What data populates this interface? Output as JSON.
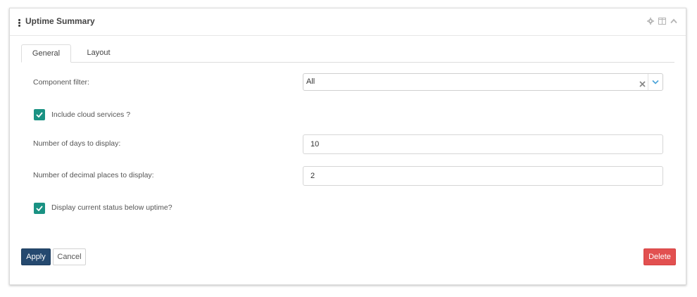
{
  "panel": {
    "title": "Uptime Summary",
    "header_icons": [
      "gear-icon",
      "columns-icon",
      "chevron-up-icon"
    ]
  },
  "tabs": [
    {
      "label": "General",
      "active": true
    },
    {
      "label": "Layout",
      "active": false
    }
  ],
  "form": {
    "component_filter": {
      "label": "Component filter:",
      "value": "All"
    },
    "include_cloud": {
      "label": "Include cloud services ?",
      "checked": true
    },
    "days": {
      "label": "Number of days to display:",
      "value": "10"
    },
    "decimals": {
      "label": "Number of decimal places to display:",
      "value": "2"
    },
    "display_status": {
      "label": "Display current status below uptime?",
      "checked": true
    }
  },
  "buttons": {
    "apply": "Apply",
    "cancel": "Cancel",
    "delete": "Delete"
  },
  "colors": {
    "checkbox": "#1a9283",
    "apply": "#25496f",
    "delete": "#e25050",
    "select_arrow": "#4aa3d8"
  }
}
